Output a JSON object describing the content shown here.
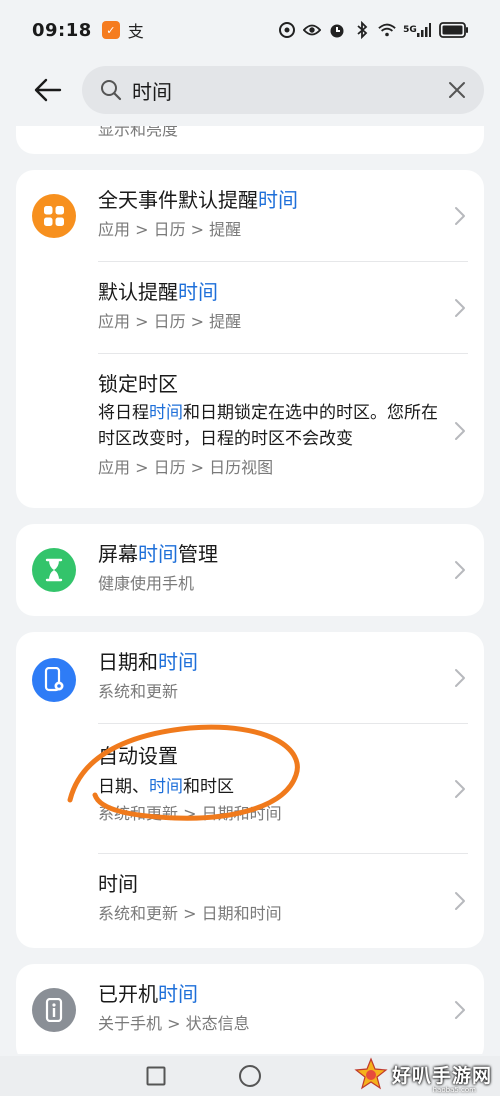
{
  "status_bar": {
    "time": "09:18",
    "badge_glyph": "✓",
    "app_glyph": "支",
    "network": "5G"
  },
  "search": {
    "query": "时间",
    "placeholder": ""
  },
  "cards": {
    "top_partial": {
      "crumb": "显示和亮度"
    },
    "calendar": {
      "icon_color": "#f7901e",
      "items": [
        {
          "title_pre": "全天事件默认提醒",
          "title_hl": "时间",
          "title_post": "",
          "crumb": "应用 > 日历 > 提醒"
        },
        {
          "title_pre": "默认提醒",
          "title_hl": "时间",
          "title_post": "",
          "crumb": "应用 > 日历 > 提醒"
        },
        {
          "title": "锁定时区",
          "desc_pre": "将日程",
          "desc_hl": "时间",
          "desc_post": "和日期锁定在选中的时区。您所在时区改变时，日程的时区不会改变",
          "crumb": "应用 > 日历 > 日历视图"
        }
      ]
    },
    "screen_time": {
      "icon_color": "#33c46b",
      "title_pre": "屏幕",
      "title_hl": "时间",
      "title_post": "管理",
      "crumb": "健康使用手机"
    },
    "system": {
      "icon_color": "#2e7cf6",
      "items": [
        {
          "title_pre": "日期和",
          "title_hl": "时间",
          "title_post": "",
          "crumb": "系统和更新"
        },
        {
          "title": "自动设置",
          "desc_pre": "日期、",
          "desc_hl": "时间",
          "desc_post": "和时区",
          "crumb": "系统和更新 > 日期和时间"
        },
        {
          "title_hl": "时间",
          "crumb": "系统和更新 > 日期和时间"
        }
      ]
    },
    "about": {
      "icon_color": "#8a8f96",
      "title_pre": "已开机",
      "title_hl": "时间",
      "title_post": "",
      "crumb": "关于手机 > 状态信息"
    }
  },
  "watermark": {
    "text": "好叭手游网",
    "sub": "haoba5.com"
  },
  "colors": {
    "highlight": "#1e6fd9",
    "annotation": "#f07a1c"
  }
}
